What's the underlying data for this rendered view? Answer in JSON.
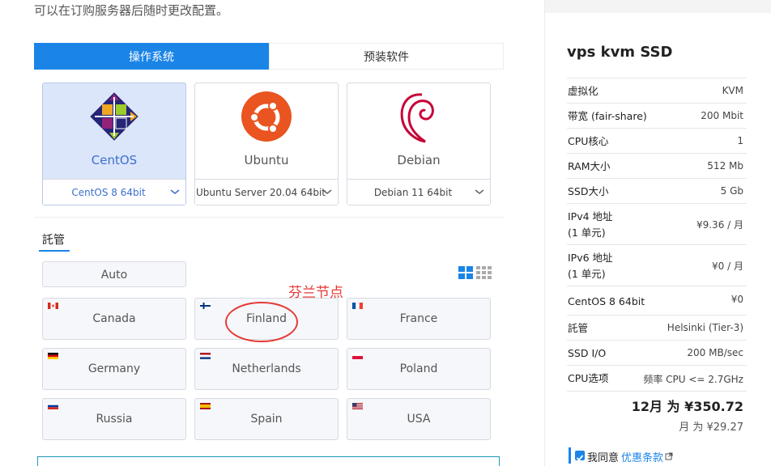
{
  "top_note": "可以在订购服务器后随时更改配置。",
  "tabs": {
    "os": "操作系统",
    "preinstalled": "预装软件"
  },
  "os_cards": [
    {
      "name": "CentOS",
      "version": "CentOS 8 64bit",
      "icon": "centos-logo"
    },
    {
      "name": "Ubuntu",
      "version": "Ubuntu Server 20.04 64bit",
      "icon": "ubuntu-logo"
    },
    {
      "name": "Debian",
      "version": "Debian 11 64bit",
      "icon": "debian-logo"
    }
  ],
  "hosting": {
    "title": "託管",
    "auto": "Auto",
    "locations": [
      "Canada",
      "Finland",
      "France",
      "Germany",
      "Netherlands",
      "Poland",
      "Russia",
      "Spain",
      "USA"
    ]
  },
  "annotation": {
    "text": "芬兰节点",
    "color": "#e53935"
  },
  "panel": {
    "title": "vps kvm SSD",
    "rows": [
      {
        "label": "虚拟化",
        "value": "KVM"
      },
      {
        "label": "带宽 (fair-share)",
        "value": "200 Mbit"
      },
      {
        "label": "CPU核心",
        "value": "1"
      },
      {
        "label": "RAM大小",
        "value": "512 Mb"
      },
      {
        "label": "SSD大小",
        "value": "5 Gb"
      },
      {
        "label_line1": "IPv4 地址",
        "label_line2": "(1 单元)",
        "value": "¥9.36 / 月"
      },
      {
        "label_line1": "IPv6 地址",
        "label_line2": "(1 单元)",
        "value": "¥0 / 月"
      },
      {
        "label": "CentOS 8 64bit",
        "value": "¥0"
      },
      {
        "label": "託管",
        "value": "Helsinki (Tier-3)"
      },
      {
        "label": "SSD I/O",
        "value": "200 MB/sec"
      },
      {
        "label": "CPU选项",
        "value": "频率 CPU <= 2.7GHz"
      }
    ],
    "total_year": "12月 为 ¥350.72",
    "total_month": "月 为 ¥29.27",
    "agree_text": "我同意",
    "terms_link": "优惠条款"
  },
  "colors": {
    "accent": "#1b84e7",
    "selected_bg": "#dce6fa",
    "annotation": "#e53935"
  }
}
